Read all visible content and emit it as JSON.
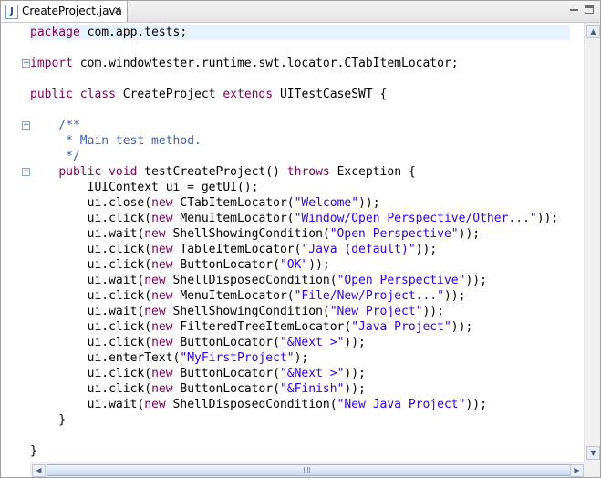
{
  "tab": {
    "icon": "java-file-icon",
    "title": "CreateProject.java",
    "close": "✕"
  },
  "window_buttons": {
    "minimize": "minimize-icon",
    "maximize": "maximize-icon"
  },
  "code": [
    {
      "fold": "",
      "parts": [
        {
          "t": "package",
          "c": "kw"
        },
        {
          "t": " com.app.tests;"
        }
      ]
    },
    {
      "fold": "",
      "parts": []
    },
    {
      "fold": "plus",
      "parts": [
        {
          "t": "import",
          "c": "kw"
        },
        {
          "t": " com.windowtester.runtime.swt.locator.CTabItemLocator;"
        }
      ]
    },
    {
      "fold": "",
      "parts": []
    },
    {
      "fold": "",
      "parts": [
        {
          "t": "public",
          "c": "kw"
        },
        {
          "t": " "
        },
        {
          "t": "class",
          "c": "kw"
        },
        {
          "t": " CreateProject "
        },
        {
          "t": "extends",
          "c": "kw"
        },
        {
          "t": " UITestCaseSWT {"
        }
      ]
    },
    {
      "fold": "",
      "parts": []
    },
    {
      "fold": "minus",
      "parts": [
        {
          "t": "    "
        },
        {
          "t": "/**",
          "c": "doc"
        }
      ]
    },
    {
      "fold": "",
      "parts": [
        {
          "t": "     "
        },
        {
          "t": "* Main test method.",
          "c": "doc"
        }
      ]
    },
    {
      "fold": "",
      "parts": [
        {
          "t": "     "
        },
        {
          "t": "*/",
          "c": "doc"
        }
      ]
    },
    {
      "fold": "minus",
      "parts": [
        {
          "t": "    "
        },
        {
          "t": "public",
          "c": "kw"
        },
        {
          "t": " "
        },
        {
          "t": "void",
          "c": "kw"
        },
        {
          "t": " testCreateProject() "
        },
        {
          "t": "throws",
          "c": "kw"
        },
        {
          "t": " Exception {"
        }
      ]
    },
    {
      "fold": "",
      "parts": [
        {
          "t": "        IUIContext ui = getUI();"
        }
      ]
    },
    {
      "fold": "",
      "parts": [
        {
          "t": "        ui.close("
        },
        {
          "t": "new",
          "c": "kw"
        },
        {
          "t": " CTabItemLocator("
        },
        {
          "t": "\"Welcome\"",
          "c": "str"
        },
        {
          "t": "));"
        }
      ]
    },
    {
      "fold": "",
      "parts": [
        {
          "t": "        ui.click("
        },
        {
          "t": "new",
          "c": "kw"
        },
        {
          "t": " MenuItemLocator("
        },
        {
          "t": "\"Window/Open Perspective/Other...\"",
          "c": "str"
        },
        {
          "t": "));"
        }
      ]
    },
    {
      "fold": "",
      "parts": [
        {
          "t": "        ui.wait("
        },
        {
          "t": "new",
          "c": "kw"
        },
        {
          "t": " ShellShowingCondition("
        },
        {
          "t": "\"Open Perspective\"",
          "c": "str"
        },
        {
          "t": "));"
        }
      ]
    },
    {
      "fold": "",
      "parts": [
        {
          "t": "        ui.click("
        },
        {
          "t": "new",
          "c": "kw"
        },
        {
          "t": " TableItemLocator("
        },
        {
          "t": "\"Java (default)\"",
          "c": "str"
        },
        {
          "t": "));"
        }
      ]
    },
    {
      "fold": "",
      "parts": [
        {
          "t": "        ui.click("
        },
        {
          "t": "new",
          "c": "kw"
        },
        {
          "t": " ButtonLocator("
        },
        {
          "t": "\"OK\"",
          "c": "str"
        },
        {
          "t": "));"
        }
      ]
    },
    {
      "fold": "",
      "parts": [
        {
          "t": "        ui.wait("
        },
        {
          "t": "new",
          "c": "kw"
        },
        {
          "t": " ShellDisposedCondition("
        },
        {
          "t": "\"Open Perspective\"",
          "c": "str"
        },
        {
          "t": "));"
        }
      ]
    },
    {
      "fold": "",
      "parts": [
        {
          "t": "        ui.click("
        },
        {
          "t": "new",
          "c": "kw"
        },
        {
          "t": " MenuItemLocator("
        },
        {
          "t": "\"File/New/Project...\"",
          "c": "str"
        },
        {
          "t": "));"
        }
      ]
    },
    {
      "fold": "",
      "parts": [
        {
          "t": "        ui.wait("
        },
        {
          "t": "new",
          "c": "kw"
        },
        {
          "t": " ShellShowingCondition("
        },
        {
          "t": "\"New Project\"",
          "c": "str"
        },
        {
          "t": "));"
        }
      ]
    },
    {
      "fold": "",
      "parts": [
        {
          "t": "        ui.click("
        },
        {
          "t": "new",
          "c": "kw"
        },
        {
          "t": " FilteredTreeItemLocator("
        },
        {
          "t": "\"Java Project\"",
          "c": "str"
        },
        {
          "t": "));"
        }
      ]
    },
    {
      "fold": "",
      "parts": [
        {
          "t": "        ui.click("
        },
        {
          "t": "new",
          "c": "kw"
        },
        {
          "t": " ButtonLocator("
        },
        {
          "t": "\"&Next >\"",
          "c": "str"
        },
        {
          "t": "));"
        }
      ]
    },
    {
      "fold": "",
      "parts": [
        {
          "t": "        ui.enterText("
        },
        {
          "t": "\"MyFirstProject\"",
          "c": "str"
        },
        {
          "t": ");"
        }
      ]
    },
    {
      "fold": "",
      "parts": [
        {
          "t": "        ui.click("
        },
        {
          "t": "new",
          "c": "kw"
        },
        {
          "t": " ButtonLocator("
        },
        {
          "t": "\"&Next >\"",
          "c": "str"
        },
        {
          "t": "));"
        }
      ]
    },
    {
      "fold": "",
      "parts": [
        {
          "t": "        ui.click("
        },
        {
          "t": "new",
          "c": "kw"
        },
        {
          "t": " ButtonLocator("
        },
        {
          "t": "\"&Finish\"",
          "c": "str"
        },
        {
          "t": "));"
        }
      ]
    },
    {
      "fold": "",
      "parts": [
        {
          "t": "        ui.wait("
        },
        {
          "t": "new",
          "c": "kw"
        },
        {
          "t": " ShellDisposedCondition("
        },
        {
          "t": "\"New Java Project\"",
          "c": "str"
        },
        {
          "t": "));"
        }
      ]
    },
    {
      "fold": "",
      "parts": [
        {
          "t": "    }"
        }
      ]
    },
    {
      "fold": "",
      "parts": []
    },
    {
      "fold": "",
      "parts": [
        {
          "t": "}"
        }
      ]
    }
  ],
  "colors": {
    "keyword": "#7f0055",
    "string": "#2a00ff",
    "javadoc": "#3f5fbf",
    "current_line": "#e8f2fe"
  }
}
